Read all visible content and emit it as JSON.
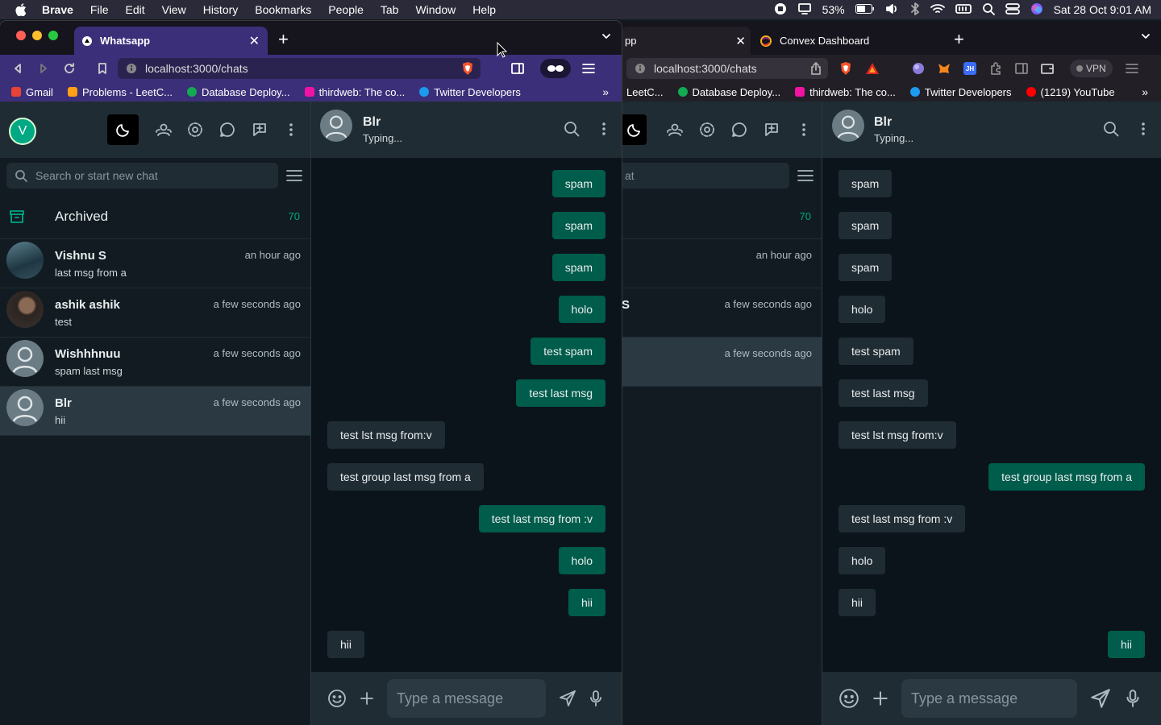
{
  "menubar": {
    "items": [
      "Brave",
      "File",
      "Edit",
      "View",
      "History",
      "Bookmarks",
      "People",
      "Tab",
      "Window",
      "Help"
    ],
    "battery": "53%",
    "datetime": "Sat 28 Oct  9:01 AM"
  },
  "left_window": {
    "tab_title": "Whatsapp",
    "url": "localhost:3000/chats",
    "bookmarks": [
      "Gmail",
      "Problems - LeetC...",
      "Database Deploy...",
      "thirdweb: The co...",
      "Twitter Developers"
    ]
  },
  "right_window": {
    "tab1_title": "pp",
    "tab2_title": "Convex Dashboard",
    "url": "localhost:3000/chats",
    "vpn_label": "VPN",
    "bookmarks": [
      "LeetC...",
      "Database Deploy...",
      "thirdweb: The co...",
      "Twitter Developers",
      "(1219) YouTube"
    ]
  },
  "sidebar": {
    "user_initial": "V",
    "search_placeholder": "Search or start new chat",
    "search_partial": "at",
    "archived_label": "Archived",
    "archived_count": "70",
    "chats": [
      {
        "name": "Vishnu S",
        "last": "last msg from a",
        "time": "an hour ago"
      },
      {
        "name": "ashik ashik",
        "last": "test",
        "time": "a few seconds ago"
      },
      {
        "name": "Wishhhnuu",
        "last": "spam last msg",
        "time": "a few seconds ago"
      },
      {
        "name": "Blr",
        "last": "hii",
        "time": "a few seconds ago"
      }
    ],
    "right_partial_name": "S"
  },
  "chat": {
    "name": "Blr",
    "status": "Typing...",
    "composer_placeholder": "Type a message",
    "messages": [
      "spam",
      "spam",
      "spam",
      "holo",
      "test spam",
      "test last msg",
      "test lst msg from:v",
      "test group last msg from a",
      "test last msg from :v",
      "holo",
      "hii",
      "hii"
    ],
    "left_directions": [
      "out",
      "out",
      "out",
      "out",
      "out",
      "out",
      "in",
      "in",
      "out",
      "out",
      "out",
      "in"
    ],
    "right_directions": [
      "in",
      "in",
      "in",
      "in",
      "in",
      "in",
      "in",
      "out",
      "in",
      "in",
      "in",
      "out"
    ]
  },
  "colors": {
    "accent": "#00a884",
    "outgoing": "#005c4b",
    "incoming": "#202c33",
    "brave_tab": "#3c2f7a"
  }
}
